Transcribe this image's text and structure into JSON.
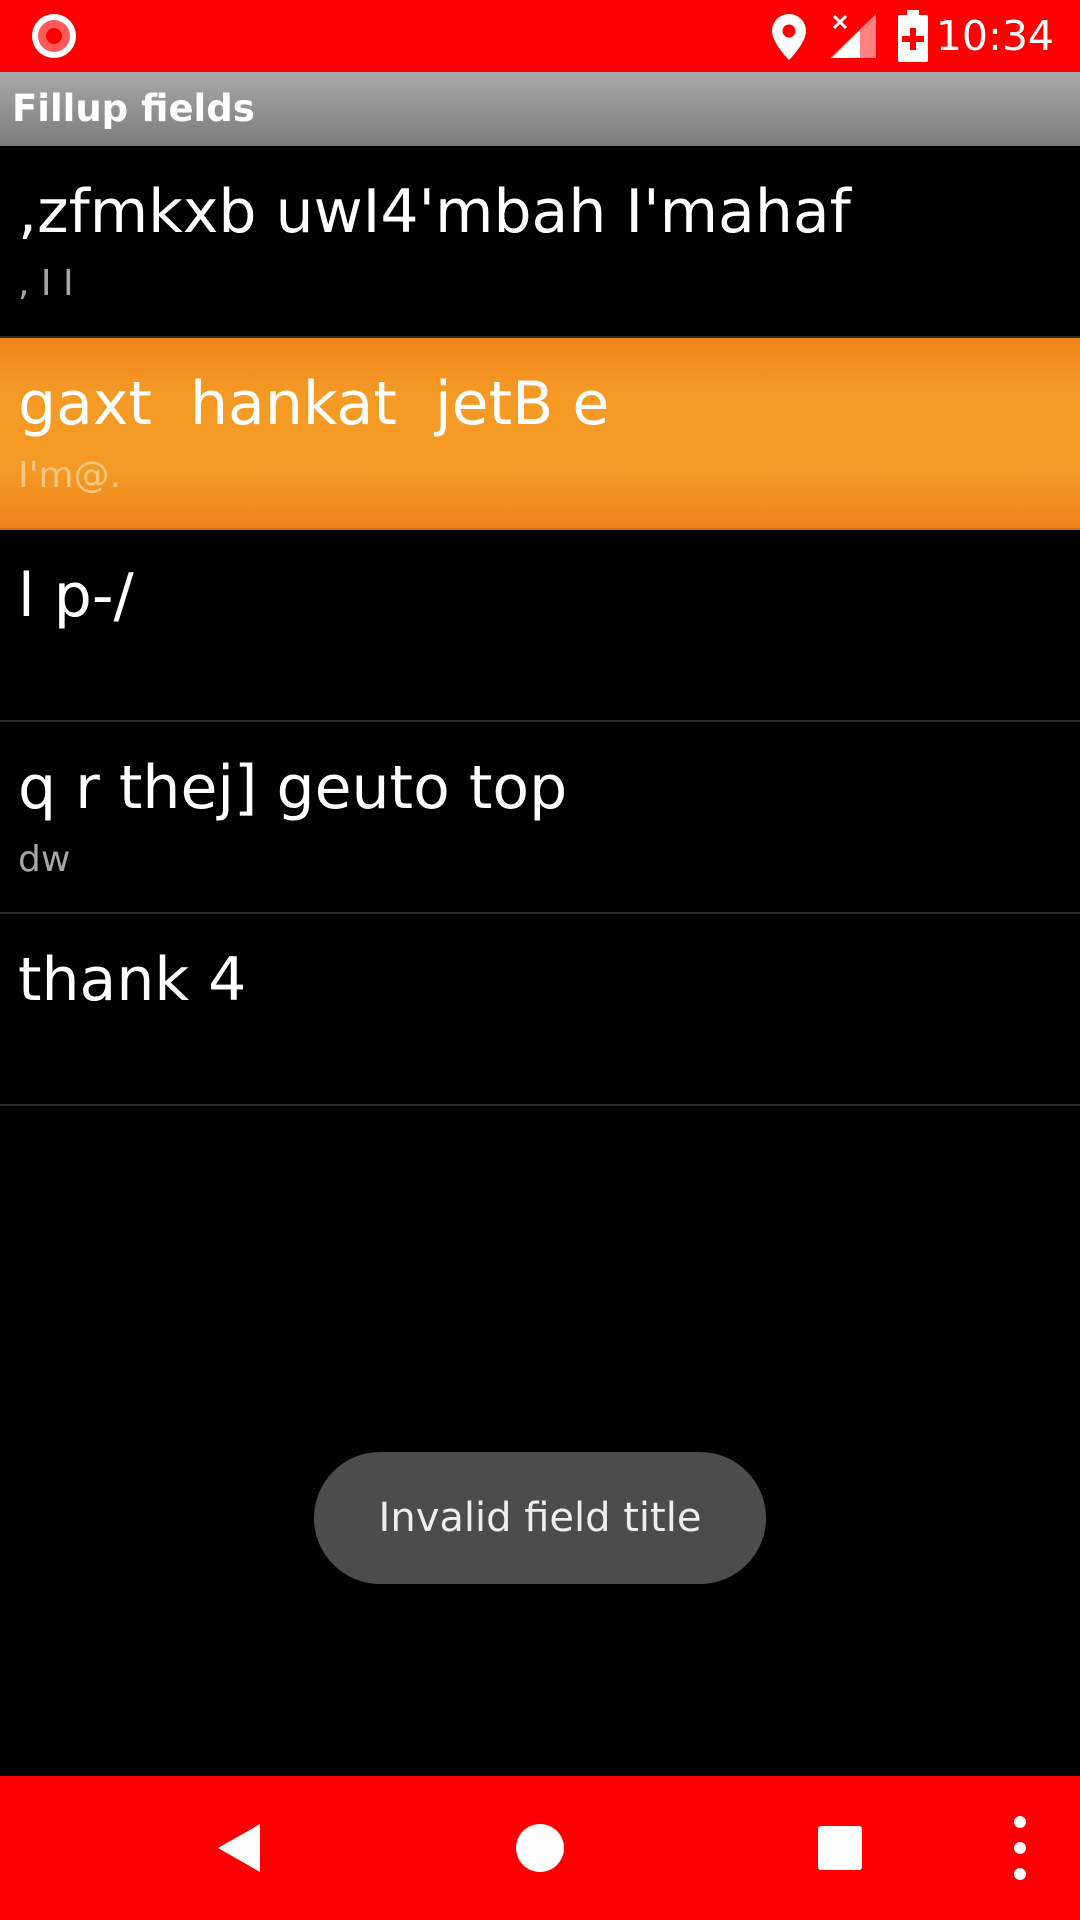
{
  "status_bar": {
    "time": "10:34",
    "icons": [
      "record-icon",
      "location-icon",
      "signal-icon",
      "battery-icon"
    ]
  },
  "title_bar": {
    "title": "Fillup fields"
  },
  "fields": [
    {
      "title": ",zfmkxb uwI4'mbah I'mahaf",
      "subtitle": ", I I"
    },
    {
      "title": "gaxt  hankat  jetB e",
      "subtitle": "I'm@."
    },
    {
      "title": "l p-/",
      "subtitle": ""
    },
    {
      "title": "q r thej] geuto top",
      "subtitle": "dw"
    },
    {
      "title": "thank 4",
      "subtitle": ""
    }
  ],
  "selected_index": 1,
  "toast": {
    "message": "Invalid field title"
  },
  "nav_bar": {
    "buttons": [
      "back-icon",
      "home-icon",
      "recents-icon",
      "overflow-menu-icon"
    ]
  },
  "colors": {
    "status_bar": "#ff0000",
    "nav_bar": "#ff0000",
    "selected_item": "#f49a25",
    "background": "#000000",
    "toast": "#4c4c4c"
  }
}
